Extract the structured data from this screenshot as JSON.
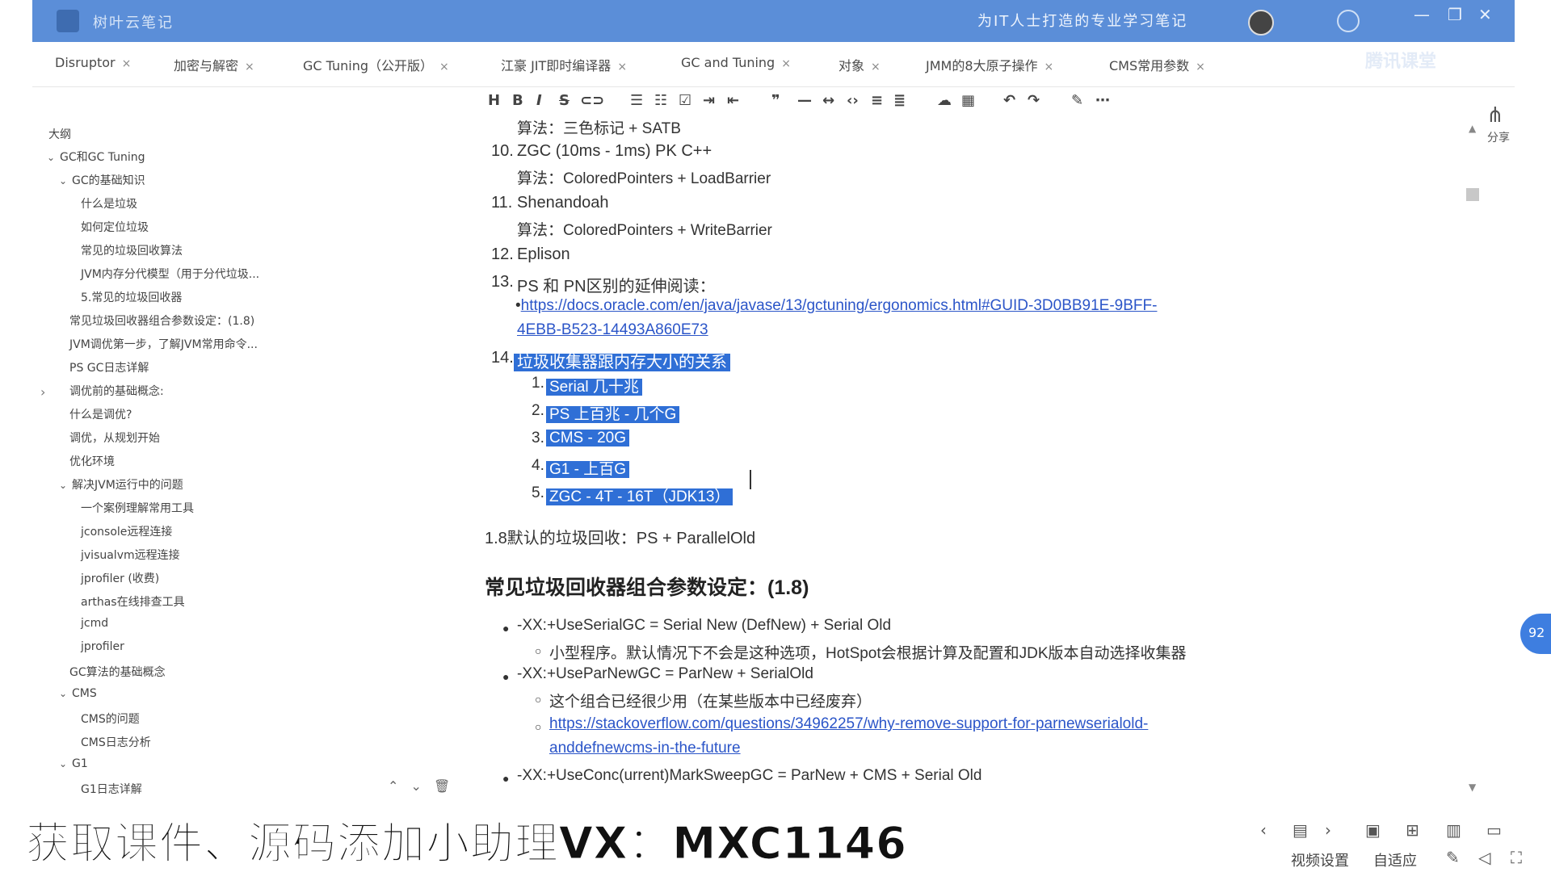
{
  "titlebar": {
    "app_name": "树叶云笔记",
    "slogan": "为IT人士打造的专业学习笔记"
  },
  "tabs": [
    {
      "label": "Disruptor"
    },
    {
      "label": "加密与解密"
    },
    {
      "label": "GC Tuning（公开版）"
    },
    {
      "label": "江豪 JIT即时编译器"
    },
    {
      "label": "GC and Tuning"
    },
    {
      "label": "对象"
    },
    {
      "label": "JMM的8大原子操作"
    },
    {
      "label": "CMS常用参数"
    }
  ],
  "tab_watermark": "腾讯课堂",
  "sidebar": {
    "outline_title": "大纲",
    "items": [
      "GC和GC Tuning",
      "GC的基础知识",
      "什么是垃圾",
      "如何定位垃圾",
      "常见的垃圾回收算法",
      "JVM内存分代模型（用于分代垃圾...",
      "5.常见的垃圾回收器",
      "常见垃圾回收器组合参数设定：(1.8)",
      "JVM调优第一步，了解JVM常用命令...",
      "PS GC日志详解",
      "调优前的基础概念:",
      "什么是调优?",
      "调优，从规划开始",
      "优化环境",
      "解决JVM运行中的问题",
      "一个案例理解常用工具",
      "jconsole远程连接",
      "jvisualvm远程连接",
      "jprofiler (收费)",
      "arthas在线排查工具",
      "jcmd",
      "jprofiler",
      "GC算法的基础概念",
      "CMS",
      "CMS的问题",
      "CMS日志分析",
      "G1",
      "G1日志详解"
    ]
  },
  "content": {
    "line_top": "算法：三色标记 + SATB",
    "item10_num": "10.",
    "item10": "ZGC (10ms - 1ms) PK C++",
    "item10_algo": "算法：ColoredPointers + LoadBarrier",
    "item11_num": "11.",
    "item11": "Shenandoah",
    "item11_algo": "算法：ColoredPointers + WriteBarrier",
    "item12_num": "12.",
    "item12": "Eplison",
    "item13_num": "13.",
    "item13": "PS 和 PN区别的延伸阅读：",
    "item13_link1": "https://docs.oracle.com/en/java/javase/13/gctuning/ergonomics.html#GUID-3D0BB91E-9BFF-",
    "item13_link2": "4EBB-B523-14493A860E73",
    "item14_num": "14.",
    "item14": "垃圾收集器跟内存大小的关系",
    "sub": [
      {
        "num": "1.",
        "text": "Serial 几十兆"
      },
      {
        "num": "2.",
        "text": "PS 上百兆 - 几个G"
      },
      {
        "num": "3.",
        "text": "CMS - 20G"
      },
      {
        "num": "4.",
        "text": "G1 - 上百G"
      },
      {
        "num": "5.",
        "text": "ZGC - 4T - 16T（JDK13）"
      }
    ],
    "default_gc": "1.8默认的垃圾回收：PS + ParallelOld",
    "heading": "常见垃圾回收器组合参数设定：(1.8)",
    "b1": "-XX:+UseSerialGC = Serial New (DefNew) + Serial Old",
    "b1_sub": "小型程序。默认情况下不会是这种选项，HotSpot会根据计算及配置和JDK版本自动选择收集器",
    "b2": "-XX:+UseParNewGC = ParNew + SerialOld",
    "b2_sub": "这个组合已经很少用（在某些版本中已经废弃）",
    "b2_link1": "https://stackoverflow.com/questions/34962257/why-remove-support-for-parnewserialold-",
    "b2_link2": "anddefnewcms-in-the-future",
    "b3": "-XX:+UseConc(urrent)MarkSweepGC = ParNew + CMS + Serial Old"
  },
  "share_label": "分享",
  "side_bubble": "92",
  "caption": "获取课件、源码添加小助理VX：MXC1146",
  "player": {
    "video_settings": "视频设置",
    "auto_fit": "自适应"
  },
  "colors": {
    "titlebar": "#5b8ed8",
    "selection": "#2f6fd6",
    "link": "#2b55c8"
  }
}
